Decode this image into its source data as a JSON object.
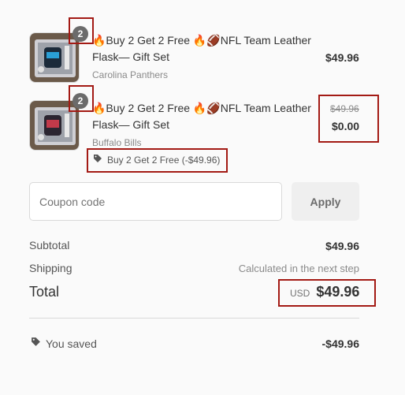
{
  "items": [
    {
      "quantity": "2",
      "title_line1": "🔥Buy 2 Get 2 Free 🔥🏈NFL Team Leather",
      "title_line2": "Flask— Gift Set",
      "variant": "Carolina Panthers",
      "price": "$49.96"
    },
    {
      "quantity": "2",
      "title_line1": "🔥Buy 2 Get 2 Free 🔥🏈NFL Team Leather",
      "title_line2": "Flask— Gift Set",
      "variant": "Buffalo Bills",
      "original_price": "$49.96",
      "price": "$0.00",
      "discount": "Buy 2 Get 2 Free (-$49.96)"
    }
  ],
  "coupon": {
    "placeholder": "Coupon code",
    "apply_label": "Apply"
  },
  "summary": {
    "subtotal_label": "Subtotal",
    "subtotal_value": "$49.96",
    "shipping_label": "Shipping",
    "shipping_value": "Calculated in the next step",
    "total_label": "Total",
    "currency": "USD",
    "total_value": "$49.96",
    "saved_label": "You saved",
    "saved_value": "-$49.96"
  },
  "colors": {
    "highlight": "#a31a14",
    "badge": "#6b6b6b"
  },
  "icons": {
    "tag": "tag-icon"
  }
}
